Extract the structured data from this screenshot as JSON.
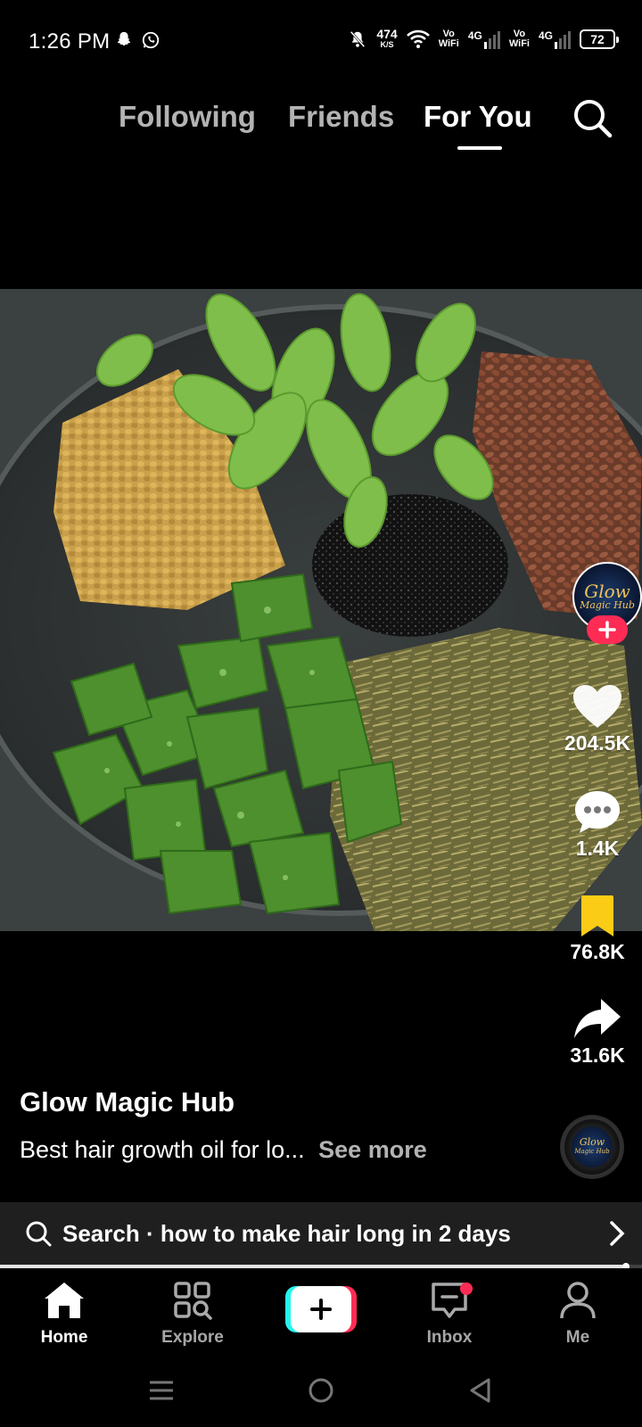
{
  "status_bar": {
    "time": "1:26 PM",
    "net_speed_value": "474",
    "net_speed_unit": "K/S",
    "sim1_label_top": "Vo",
    "sim1_label_bottom": "WiFi",
    "sim1_network": "4G",
    "sim2_label_top": "Vo",
    "sim2_label_bottom": "WiFi",
    "sim2_network": "4G",
    "battery": "72"
  },
  "top_nav": {
    "tabs": [
      {
        "label": "Following"
      },
      {
        "label": "Friends"
      },
      {
        "label": "For You",
        "active": true
      }
    ]
  },
  "video": {
    "description_icon": "herbal-ingredients-bowl"
  },
  "creator": {
    "avatar_line1": "Glow",
    "avatar_line2": "Magic Hub",
    "name": "Glow Magic Hub"
  },
  "actions": {
    "likes": "204.5K",
    "comments": "1.4K",
    "saves": "76.8K",
    "shares": "31.6K",
    "save_color": "#facc15",
    "follow_color": "#fe2c55"
  },
  "caption": {
    "text": "Best hair growth oil for lo...",
    "see_more": "See more"
  },
  "music_disc": {
    "line1": "Glow",
    "line2": "Magic Hub"
  },
  "search_suggestion": {
    "text": "Search · how to make hair long in 2 days"
  },
  "playback": {
    "progress_fraction": 0.975
  },
  "bottom_nav": {
    "items": [
      {
        "label": "Home",
        "icon": "home-icon",
        "active": true
      },
      {
        "label": "Explore",
        "icon": "explore-icon"
      },
      {
        "label": "",
        "icon": "create-icon"
      },
      {
        "label": "Inbox",
        "icon": "inbox-icon",
        "badge": true
      },
      {
        "label": "Me",
        "icon": "profile-icon"
      }
    ]
  }
}
